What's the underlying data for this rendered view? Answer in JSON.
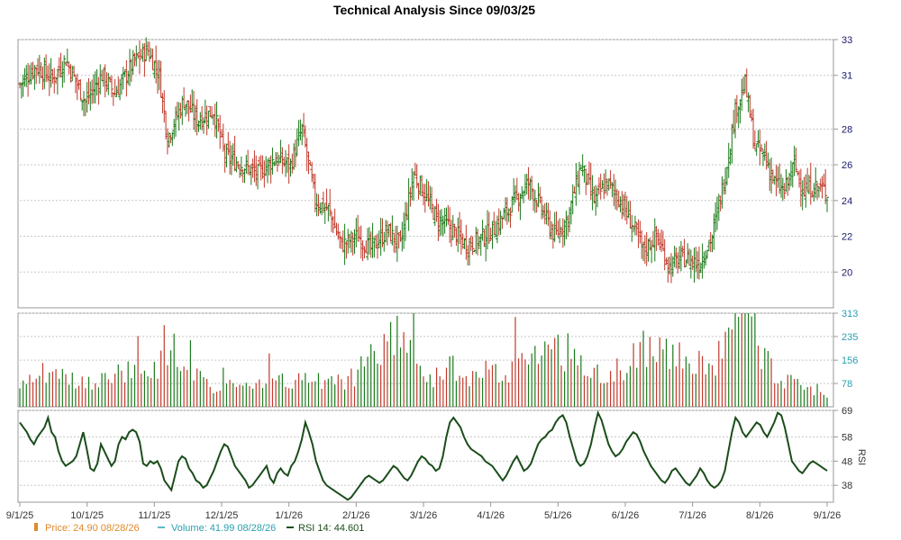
{
  "chart_data": {
    "type": "ohlc",
    "title": "Technical Analysis Since 09/03/25",
    "x_ticks": [
      "9/1/25",
      "10/1/25",
      "11/1/25",
      "12/1/25",
      "1/1/26",
      "2/1/26",
      "3/1/26",
      "4/1/26",
      "5/1/26",
      "6/1/26",
      "7/1/26",
      "8/1/26",
      "9/1/26"
    ],
    "price_axis": {
      "ticks": [
        20,
        22,
        24,
        26,
        28,
        31,
        33
      ],
      "ylim": [
        18.0,
        33.0
      ]
    },
    "volume_axis": {
      "ticks": [
        78,
        156,
        235,
        313
      ],
      "ylim": [
        0,
        313
      ]
    },
    "rsi_axis": {
      "label": "RSI",
      "ticks": [
        38,
        48,
        58,
        69
      ],
      "ylim": [
        31,
        69
      ]
    },
    "legend": {
      "price": "Price: 24.90  08/28/26",
      "volume": "Volume: 41.99  08/28/26",
      "rsi": "RSI 14: 44.601"
    },
    "colors": {
      "up": "#1a7a1a",
      "down": "#c0392b",
      "rsi_line": "#1b4d1b",
      "price_legend": "#e08a2a",
      "volume_legend": "#2aa0b0",
      "axis_price": "#1a1a6e"
    },
    "price_anchors": [
      [
        0,
        30.5
      ],
      [
        10,
        31.5
      ],
      [
        20,
        30.8
      ],
      [
        28,
        31.9
      ],
      [
        40,
        29.5
      ],
      [
        50,
        31.0
      ],
      [
        58,
        30.0
      ],
      [
        70,
        31.8
      ],
      [
        78,
        32.4
      ],
      [
        85,
        31.0
      ],
      [
        90,
        27.5
      ],
      [
        100,
        29.6
      ],
      [
        108,
        28.5
      ],
      [
        118,
        29.0
      ],
      [
        125,
        26.5
      ],
      [
        135,
        26.0
      ],
      [
        145,
        25.5
      ],
      [
        155,
        26.3
      ],
      [
        165,
        26.0
      ],
      [
        172,
        28.0
      ],
      [
        180,
        24.0
      ],
      [
        188,
        23.5
      ],
      [
        196,
        21.5
      ],
      [
        206,
        22.0
      ],
      [
        214,
        21.3
      ],
      [
        224,
        22.3
      ],
      [
        232,
        21.5
      ],
      [
        240,
        25.5
      ],
      [
        246,
        24.5
      ],
      [
        254,
        23.0
      ],
      [
        262,
        22.5
      ],
      [
        272,
        21.5
      ],
      [
        280,
        21.8
      ],
      [
        290,
        22.5
      ],
      [
        300,
        23.8
      ],
      [
        310,
        25.0
      ],
      [
        318,
        23.5
      ],
      [
        326,
        22.0
      ],
      [
        334,
        23.0
      ],
      [
        342,
        26.0
      ],
      [
        350,
        24.0
      ],
      [
        358,
        25.0
      ],
      [
        366,
        24.0
      ],
      [
        374,
        22.5
      ],
      [
        380,
        21.2
      ],
      [
        388,
        22.0
      ],
      [
        396,
        20.3
      ],
      [
        404,
        20.8
      ],
      [
        414,
        20.5
      ],
      [
        422,
        22.0
      ],
      [
        430,
        25.5
      ],
      [
        436,
        29.0
      ],
      [
        442,
        30.5
      ],
      [
        448,
        27.0
      ],
      [
        454,
        26.5
      ],
      [
        460,
        25.0
      ],
      [
        466,
        24.5
      ],
      [
        472,
        26.0
      ],
      [
        478,
        24.5
      ],
      [
        484,
        24.8
      ],
      [
        492,
        24.5
      ]
    ],
    "volume_anchors": [
      [
        0,
        70
      ],
      [
        14,
        120
      ],
      [
        40,
        80
      ],
      [
        70,
        140
      ],
      [
        90,
        160
      ],
      [
        120,
        70
      ],
      [
        160,
        90
      ],
      [
        200,
        100
      ],
      [
        230,
        260
      ],
      [
        250,
        110
      ],
      [
        300,
        140
      ],
      [
        330,
        210
      ],
      [
        360,
        110
      ],
      [
        380,
        220
      ],
      [
        420,
        140
      ],
      [
        442,
        313
      ],
      [
        460,
        120
      ],
      [
        492,
        42
      ]
    ],
    "rsi_values": [
      64,
      62,
      60,
      57,
      55,
      58,
      60,
      62,
      66,
      60,
      58,
      52,
      48,
      46,
      47,
      48,
      50,
      55,
      60,
      53,
      45,
      44,
      47,
      55,
      52,
      49,
      46,
      48,
      55,
      58,
      57,
      60,
      61,
      60,
      56,
      47,
      46,
      48,
      47,
      48,
      45,
      40,
      38,
      36,
      42,
      48,
      50,
      49,
      45,
      43,
      40,
      39,
      37,
      38,
      41,
      44,
      48,
      52,
      55,
      54,
      50,
      46,
      44,
      42,
      40,
      37,
      38,
      40,
      42,
      44,
      46,
      41,
      39,
      43,
      45,
      43,
      42,
      46,
      48,
      52,
      57,
      64,
      60,
      55,
      48,
      44,
      40,
      38,
      37,
      36,
      35,
      34,
      33,
      32,
      33,
      35,
      37,
      39,
      41,
      42,
      41,
      40,
      39,
      40,
      42,
      44,
      46,
      45,
      43,
      41,
      40,
      42,
      45,
      48,
      50,
      49,
      47,
      46,
      44,
      45,
      50,
      58,
      64,
      66,
      64,
      62,
      58,
      55,
      53,
      52,
      51,
      50,
      48,
      47,
      46,
      44,
      42,
      40,
      42,
      45,
      48,
      50,
      47,
      44,
      45,
      47,
      51,
      55,
      57,
      58,
      60,
      61,
      64,
      66,
      67,
      64,
      58,
      53,
      48,
      46,
      47,
      50,
      55,
      62,
      68,
      65,
      60,
      55,
      52,
      50,
      51,
      53,
      56,
      58,
      60,
      59,
      56,
      52,
      49,
      46,
      44,
      42,
      40,
      39,
      41,
      44,
      45,
      43,
      41,
      39,
      38,
      40,
      42,
      45,
      43,
      40,
      38,
      37,
      38,
      40,
      44,
      52,
      60,
      66,
      64,
      60,
      58,
      60,
      62,
      64,
      63,
      60,
      58,
      61,
      64,
      68,
      67,
      62,
      55,
      48,
      46,
      44,
      43,
      45,
      47,
      48,
      47,
      46,
      45,
      44
    ]
  }
}
